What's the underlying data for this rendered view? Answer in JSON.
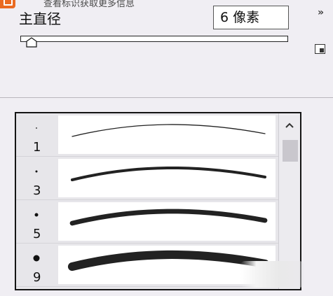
{
  "tooltip": {
    "text": "查看标识获取更多信息"
  },
  "brush": {
    "diameter_label": "主直径",
    "size_value": "6 像素",
    "slider_level": 0.02
  },
  "toolbar": {
    "menu_glyph": "»"
  },
  "presets": [
    {
      "size_label": "1",
      "stroke_weight": 1
    },
    {
      "size_label": "3",
      "stroke_weight": 3
    },
    {
      "size_label": "5",
      "stroke_weight": 5
    },
    {
      "size_label": "9",
      "stroke_weight": 9
    }
  ],
  "colors": {
    "panel_bg": "#f0eef3",
    "accent": "#ea6a21",
    "list_bg": "#e7e6ea"
  }
}
